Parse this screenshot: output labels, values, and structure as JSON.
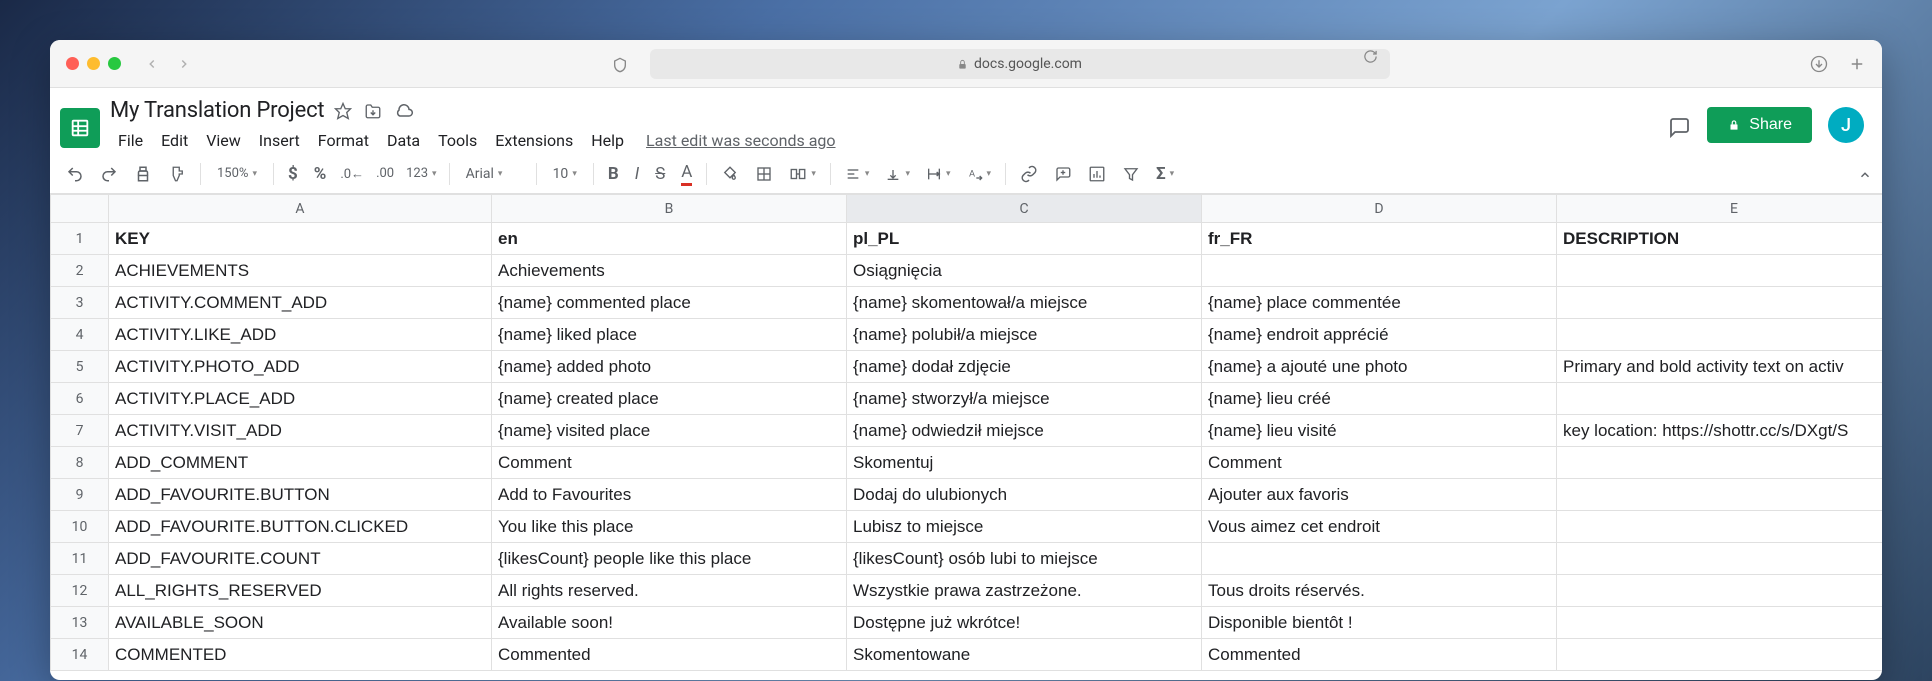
{
  "browser": {
    "url": "docs.google.com"
  },
  "doc": {
    "title": "My Translation Project",
    "last_edit": "Last edit was seconds ago"
  },
  "menus": [
    "File",
    "Edit",
    "View",
    "Insert",
    "Format",
    "Data",
    "Tools",
    "Extensions",
    "Help"
  ],
  "share_label": "Share",
  "avatar_initial": "J",
  "toolbar": {
    "zoom": "150%",
    "font": "Arial",
    "font_size": "10"
  },
  "columns": [
    "A",
    "B",
    "C",
    "D",
    "E"
  ],
  "active_column_index": 2,
  "rows": [
    {
      "n": "1",
      "cells": [
        "KEY",
        "en",
        "pl_PL",
        "fr_FR",
        "DESCRIPTION"
      ],
      "header": true
    },
    {
      "n": "2",
      "cells": [
        "ACHIEVEMENTS",
        "Achievements",
        "Osiągnięcia",
        "",
        ""
      ]
    },
    {
      "n": "3",
      "cells": [
        "ACTIVITY.COMMENT_ADD",
        "{name} commented place",
        "{name} skomentował/a miejsce",
        "{name} place commentée",
        ""
      ]
    },
    {
      "n": "4",
      "cells": [
        "ACTIVITY.LIKE_ADD",
        "{name} liked place",
        "{name} polubił/a miejsce",
        "{name} endroit apprécié",
        ""
      ]
    },
    {
      "n": "5",
      "cells": [
        "ACTIVITY.PHOTO_ADD",
        "{name} added photo",
        "{name} dodał zdjęcie",
        "{name} a ajouté une photo",
        "Primary and bold activity text on activ"
      ]
    },
    {
      "n": "6",
      "cells": [
        "ACTIVITY.PLACE_ADD",
        "{name} created place",
        "{name} stworzył/a miejsce",
        "{name} lieu créé",
        ""
      ]
    },
    {
      "n": "7",
      "cells": [
        "ACTIVITY.VISIT_ADD",
        "{name} visited place",
        "{name} odwiedził miejsce",
        "{name} lieu visité",
        "key location: https://shottr.cc/s/DXgt/S"
      ]
    },
    {
      "n": "8",
      "cells": [
        "ADD_COMMENT",
        "Comment",
        "Skomentuj",
        "Comment",
        ""
      ]
    },
    {
      "n": "9",
      "cells": [
        "ADD_FAVOURITE.BUTTON",
        "Add to Favourites",
        "Dodaj do ulubionych",
        "Ajouter aux favoris",
        ""
      ]
    },
    {
      "n": "10",
      "cells": [
        "ADD_FAVOURITE.BUTTON.CLICKED",
        "You like this place",
        "Lubisz to miejsce",
        "Vous aimez cet endroit",
        ""
      ]
    },
    {
      "n": "11",
      "cells": [
        "ADD_FAVOURITE.COUNT",
        "{likesCount} people like this place",
        "{likesCount} osób lubi to miejsce",
        "",
        ""
      ]
    },
    {
      "n": "12",
      "cells": [
        "ALL_RIGHTS_RESERVED",
        "All rights reserved.",
        "Wszystkie prawa zastrzeżone.",
        "Tous droits réservés.",
        ""
      ]
    },
    {
      "n": "13",
      "cells": [
        "AVAILABLE_SOON",
        "Available soon!",
        "Dostępne już wkrótce!",
        "Disponible bientôt !",
        ""
      ]
    },
    {
      "n": "14",
      "cells": [
        "COMMENTED",
        "Commented",
        "Skomentowane",
        "Commented",
        ""
      ]
    }
  ]
}
